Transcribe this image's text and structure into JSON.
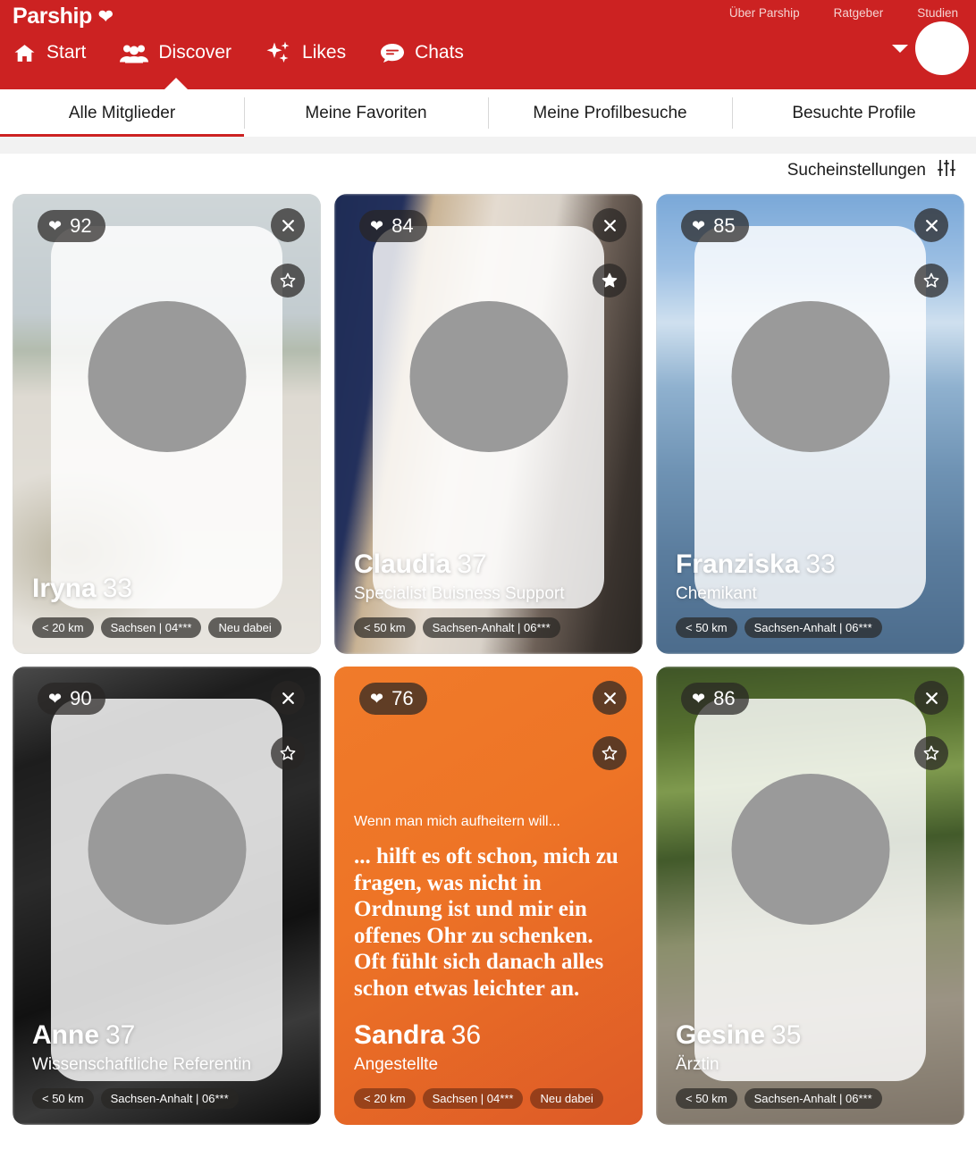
{
  "header": {
    "brand": "Parship",
    "brand_icon": "heart-icon",
    "top_links": [
      "Über Parship",
      "Ratgeber",
      "Studien"
    ],
    "nav": [
      {
        "label": "Start",
        "icon": "home-icon",
        "active": false
      },
      {
        "label": "Discover",
        "icon": "people-icon",
        "active": true
      },
      {
        "label": "Likes",
        "icon": "sparkles-icon",
        "active": false
      },
      {
        "label": "Chats",
        "icon": "chat-bubble-icon",
        "active": false
      }
    ],
    "account_caret_icon": "chevron-down-icon",
    "avatar_icon": "avatar",
    "brand_color": "#cc2222"
  },
  "tabs": [
    {
      "label": "Alle Mitglieder",
      "active": true
    },
    {
      "label": "Meine Favoriten",
      "active": false
    },
    {
      "label": "Meine Profilbesuche",
      "active": false
    },
    {
      "label": "Besuchte Profile",
      "active": false
    }
  ],
  "settings": {
    "label": "Sucheinstellungen",
    "icon": "sliders-icon"
  },
  "cards": [
    {
      "name": "Iryna",
      "age": "33",
      "job": "",
      "score": "92",
      "favorited": false,
      "tags": [
        "< 20 km",
        "Sachsen | 04***",
        "Neu dabei"
      ],
      "close_icon": "close-icon",
      "fav_icon": "star-icon",
      "score_icon": "heart-icon"
    },
    {
      "name": "Claudia",
      "age": "37",
      "job": "Specialist Buisness Support",
      "score": "84",
      "favorited": true,
      "tags": [
        "< 50 km",
        "Sachsen-Anhalt | 06***"
      ],
      "close_icon": "close-icon",
      "fav_icon": "star-filled-icon",
      "score_icon": "heart-icon"
    },
    {
      "name": "Franziska",
      "age": "33",
      "job": "Chemikant",
      "score": "85",
      "favorited": false,
      "tags": [
        "< 50 km",
        "Sachsen-Anhalt | 06***"
      ],
      "close_icon": "close-icon",
      "fav_icon": "star-icon",
      "score_icon": "heart-icon"
    },
    {
      "name": "Anne",
      "age": "37",
      "job": "Wissenschaftliche Referentin",
      "score": "90",
      "favorited": false,
      "tags": [
        "< 50 km",
        "Sachsen-Anhalt | 06***"
      ],
      "close_icon": "close-icon",
      "fav_icon": "star-icon",
      "score_icon": "heart-icon"
    },
    {
      "name": "Sandra",
      "age": "36",
      "job": "Angestellte",
      "score": "76",
      "favorited": false,
      "tags": [
        "< 20 km",
        "Sachsen | 04***",
        "Neu dabei"
      ],
      "close_icon": "close-icon",
      "fav_icon": "star-icon",
      "score_icon": "heart-icon",
      "quote_question": "Wenn man mich aufheitern will...",
      "quote_answer": "... hilft es oft schon, mich zu fragen, was nicht in Ordnung ist und mir ein offenes Ohr zu schenken. Oft fühlt sich danach alles schon etwas leichter an.",
      "accent_color": "#ee7426"
    },
    {
      "name": "Gesine",
      "age": "35",
      "job": "Ärztin",
      "score": "86",
      "favorited": false,
      "tags": [
        "< 50 km",
        "Sachsen-Anhalt | 06***"
      ],
      "close_icon": "close-icon",
      "fav_icon": "star-icon",
      "score_icon": "heart-icon"
    }
  ]
}
